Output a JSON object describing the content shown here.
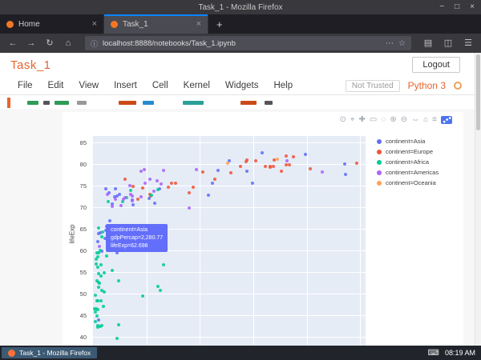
{
  "window": {
    "title": "Task_1 - Mozilla Firefox",
    "controls": [
      {
        "name": "minimize-button",
        "glyph": "−"
      },
      {
        "name": "maximize-button",
        "glyph": "□"
      },
      {
        "name": "close-button",
        "glyph": "×"
      }
    ]
  },
  "browser": {
    "tabs": [
      {
        "label": "Home",
        "active": false
      },
      {
        "label": "Task_1",
        "active": true
      }
    ],
    "tab_close_glyph": "×",
    "new_tab_glyph": "+",
    "nav_icons_left": [
      {
        "name": "back-icon",
        "glyph": "←"
      },
      {
        "name": "forward-icon",
        "glyph": "→"
      },
      {
        "name": "reload-icon",
        "glyph": "↻"
      },
      {
        "name": "home-icon",
        "glyph": "⌂"
      }
    ],
    "urlbar": {
      "info_glyph": "ⓘ",
      "url": "localhost:8888/notebooks/Task_1.ipynb",
      "page_actions_glyph": "⋯",
      "bookmark_glyph": "☆"
    },
    "nav_icons_right": [
      {
        "name": "library-icon",
        "glyph": "▤"
      },
      {
        "name": "sidebars-icon",
        "glyph": "◫"
      },
      {
        "name": "hamburger-menu-icon",
        "glyph": "☰"
      }
    ]
  },
  "jupyter": {
    "notebook_title": "Task_1",
    "logout_label": "Logout",
    "menu": [
      "File",
      "Edit",
      "View",
      "Insert",
      "Cell",
      "Kernel",
      "Widgets",
      "Help"
    ],
    "trust_badge": "Not Trusted",
    "kernel_name": "Python 3",
    "accent_color": "#e8642e"
  },
  "plot": {
    "background": "#e5ecf6",
    "ylabel": "lifeExp",
    "modebar": [
      {
        "name": "camera-snapshot-icon",
        "glyph": "⊙"
      },
      {
        "name": "zoom-icon",
        "glyph": "⌖"
      },
      {
        "name": "pan-icon",
        "glyph": "✚"
      },
      {
        "name": "box-select-icon",
        "glyph": "▭"
      },
      {
        "name": "lasso-select-icon",
        "glyph": "◌"
      },
      {
        "name": "zoom-in-icon",
        "glyph": "⊕"
      },
      {
        "name": "zoom-out-icon",
        "glyph": "⊖"
      },
      {
        "name": "autoscale-icon",
        "glyph": "⇔"
      },
      {
        "name": "reset-axes-icon",
        "glyph": "⌂"
      },
      {
        "name": "toggle-hover-icon",
        "glyph": "≡"
      },
      {
        "name": "plotly-logo-icon",
        "glyph": null
      }
    ],
    "tooltip": {
      "lines": [
        "continent=Asia",
        "gdpPercap=2,280.77",
        "lifeExp=62.698"
      ],
      "background": "#636efa"
    },
    "legend": [
      {
        "label": "continent=Asia",
        "color": "#636efa"
      },
      {
        "label": "continent=Europe",
        "color": "#EF553B"
      },
      {
        "label": "continent=Africa",
        "color": "#00cc96"
      },
      {
        "label": "continent=Americas",
        "color": "#ab63fa"
      },
      {
        "label": "continent=Oceania",
        "color": "#FFA15A"
      }
    ]
  },
  "chart_data": {
    "type": "scatter",
    "x_field": "gdpPercap",
    "y_field": "lifeExp",
    "ylabel": "lifeExp",
    "xlim": [
      0,
      51000
    ],
    "ylim": [
      37.5,
      86.5
    ],
    "y_ticks": [
      40,
      45,
      50,
      55,
      60,
      65,
      70,
      75,
      80,
      85
    ],
    "grid": true,
    "legend_position": "right",
    "series": [
      {
        "name": "continent=Asia",
        "color": "#636efa",
        "points": [
          [
            974,
            43.8
          ],
          [
            29796,
            75.6
          ],
          [
            1391,
            64.1
          ],
          [
            1714,
            59.7
          ],
          [
            4959,
            73.0
          ],
          [
            39725,
            82.2
          ],
          [
            2452,
            64.7
          ],
          [
            3541,
            70.7
          ],
          [
            11606,
            71.0
          ],
          [
            4471,
            59.5
          ],
          [
            25523,
            80.7
          ],
          [
            31656,
            82.6
          ],
          [
            4519,
            72.5
          ],
          [
            47307,
            77.6
          ],
          [
            10461,
            72.0
          ],
          [
            12452,
            74.2
          ],
          [
            3095,
            66.8
          ],
          [
            944,
            62.1
          ],
          [
            1091,
            63.8
          ],
          [
            22316,
            75.6
          ],
          [
            2606,
            65.5
          ],
          [
            7408,
            71.7
          ],
          [
            21655,
            72.8
          ],
          [
            47143,
            80.0
          ],
          [
            23348,
            78.6
          ],
          [
            3970,
            72.4
          ],
          [
            4185,
            74.2
          ],
          [
            28718,
            78.4
          ],
          [
            7458,
            70.6
          ],
          [
            2442,
            74.2
          ],
          [
            3025,
            73.4
          ],
          [
            2281,
            62.7
          ]
        ]
      },
      {
        "name": "continent=Europe",
        "color": "#EF553B",
        "points": [
          [
            5937,
            76.4
          ],
          [
            36126,
            79.8
          ],
          [
            33693,
            79.4
          ],
          [
            7446,
            74.9
          ],
          [
            10681,
            73.0
          ],
          [
            14619,
            75.6
          ],
          [
            22833,
            76.5
          ],
          [
            35278,
            78.3
          ],
          [
            33207,
            79.3
          ],
          [
            30470,
            80.7
          ],
          [
            32170,
            79.4
          ],
          [
            27538,
            79.5
          ],
          [
            18009,
            73.3
          ],
          [
            36181,
            81.8
          ],
          [
            40676,
            78.9
          ],
          [
            28570,
            80.5
          ],
          [
            9254,
            74.5
          ],
          [
            36798,
            79.8
          ],
          [
            49357,
            80.2
          ],
          [
            15390,
            75.6
          ],
          [
            20510,
            78.1
          ],
          [
            10808,
            72.5
          ],
          [
            14074,
            74.7
          ],
          [
            18678,
            74.7
          ],
          [
            25768,
            77.9
          ],
          [
            28821,
            80.9
          ],
          [
            33860,
            80.9
          ],
          [
            37506,
            81.7
          ],
          [
            8458,
            71.8
          ],
          [
            33203,
            79.4
          ]
        ]
      },
      {
        "name": "continent=Africa",
        "color": "#00cc96",
        "points": [
          [
            6223,
            72.3
          ],
          [
            4797,
            42.7
          ],
          [
            1441,
            56.7
          ],
          [
            12570,
            50.7
          ],
          [
            1217,
            52.3
          ],
          [
            430,
            49.6
          ],
          [
            2042,
            50.4
          ],
          [
            706,
            44.7
          ],
          [
            1704,
            50.7
          ],
          [
            986,
            65.2
          ],
          [
            277,
            46.5
          ],
          [
            3632,
            55.3
          ],
          [
            1545,
            48.3
          ],
          [
            2082,
            54.8
          ],
          [
            5581,
            71.3
          ],
          [
            12154,
            51.6
          ],
          [
            641,
            58.0
          ],
          [
            690,
            52.9
          ],
          [
            13206,
            56.7
          ],
          [
            752,
            59.4
          ],
          [
            1327,
            60.0
          ],
          [
            942,
            56.0
          ],
          [
            579,
            46.4
          ],
          [
            1463,
            54.1
          ],
          [
            1569,
            42.6
          ],
          [
            414,
            45.7
          ],
          [
            12120,
            74.0
          ],
          [
            1045,
            59.4
          ],
          [
            759,
            48.3
          ],
          [
            1043,
            54.5
          ],
          [
            1803,
            64.2
          ],
          [
            10957,
            72.8
          ],
          [
            2852,
            71.2
          ],
          [
            824,
            42.1
          ],
          [
            4811,
            52.9
          ],
          [
            619,
            56.9
          ],
          [
            2014,
            46.9
          ],
          [
            863,
            46.2
          ],
          [
            1712,
            63.1
          ],
          [
            863,
            42.6
          ],
          [
            926,
            48.2
          ],
          [
            9270,
            49.3
          ],
          [
            2602,
            58.6
          ],
          [
            4513,
            39.6
          ],
          [
            1107,
            52.5
          ],
          [
            883,
            58.4
          ],
          [
            7093,
            73.9
          ],
          [
            1056,
            51.5
          ],
          [
            1271,
            42.4
          ],
          [
            470,
            43.5
          ]
        ]
      },
      {
        "name": "continent=Americas",
        "color": "#ab63fa",
        "points": [
          [
            12779,
            75.3
          ],
          [
            3822,
            65.6
          ],
          [
            9066,
            72.4
          ],
          [
            36319,
            80.7
          ],
          [
            13172,
            78.6
          ],
          [
            7007,
            72.9
          ],
          [
            9645,
            78.8
          ],
          [
            8948,
            78.3
          ],
          [
            6025,
            72.2
          ],
          [
            6873,
            75.0
          ],
          [
            5728,
            71.9
          ],
          [
            5186,
            70.3
          ],
          [
            1202,
            60.9
          ],
          [
            3548,
            70.2
          ],
          [
            7321,
            72.6
          ],
          [
            11978,
            76.2
          ],
          [
            2749,
            72.9
          ],
          [
            9809,
            75.5
          ],
          [
            4173,
            71.8
          ],
          [
            7409,
            71.4
          ],
          [
            19329,
            78.7
          ],
          [
            18009,
            69.8
          ],
          [
            42952,
            78.2
          ],
          [
            10611,
            76.4
          ],
          [
            11416,
            73.7
          ]
        ]
      },
      {
        "name": "continent=Oceania",
        "color": "#FFA15A",
        "points": [
          [
            34435,
            81.2
          ],
          [
            25185,
            80.2
          ]
        ]
      }
    ]
  },
  "taskbar": {
    "window_button": "Task_1 - Mozilla Firefox",
    "clock": "08:19 AM",
    "tray_icons": [
      {
        "name": "keyboard-indicator-icon",
        "glyph": "⌨"
      }
    ]
  }
}
